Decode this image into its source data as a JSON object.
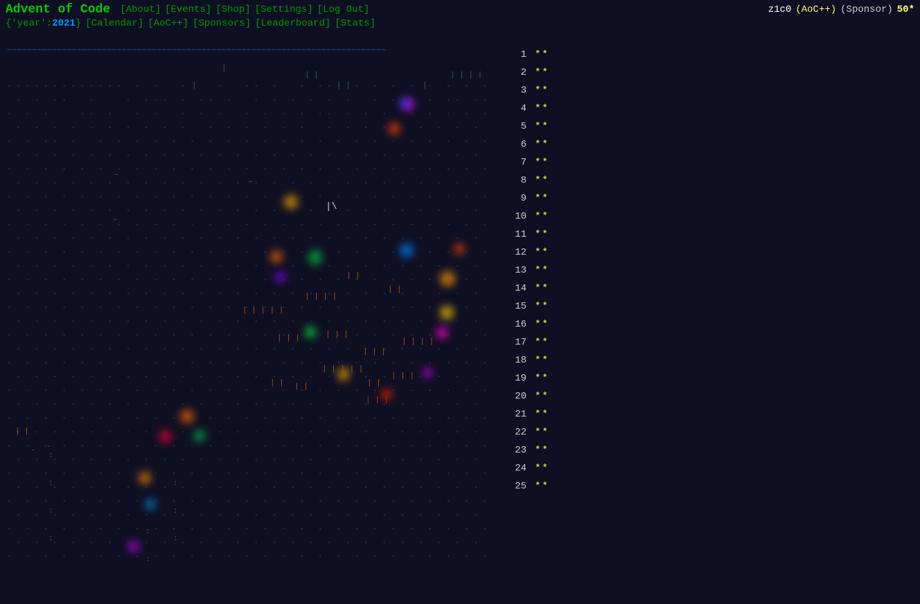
{
  "header": {
    "title": "Advent of Code",
    "nav_row1": [
      {
        "label": "[About]",
        "href": "#about"
      },
      {
        "label": "[Events]",
        "href": "#events"
      },
      {
        "label": "[Shop]",
        "href": "#shop"
      },
      {
        "label": "[Settings]",
        "href": "#settings"
      },
      {
        "label": "[Log Out]",
        "href": "#logout"
      }
    ],
    "user": {
      "name": "z1c0",
      "aocpp": "(AoC++)",
      "sponsor": "(Sponsor)",
      "stars": "50*"
    },
    "nav_row2": [
      {
        "label": "{'year':2021}"
      },
      {
        "label": "[Calendar]",
        "href": "#calendar"
      },
      {
        "label": "[AoC++]",
        "href": "#aocpp"
      },
      {
        "label": "[Sponsors]",
        "href": "#sponsors"
      },
      {
        "label": "[Leaderboard]",
        "href": "#leaderboard"
      },
      {
        "label": "[Stats]",
        "href": "#stats"
      }
    ]
  },
  "calendar": {
    "tilde_row": "~~~~~~~~~~~~~~~~~~~~~~~~~~~~~~~~~~~~~~~~~~~~~~~~~~~~~~~~~~~~~~~~~~~~~~~~~~~~"
  },
  "days": [
    {
      "num": "1",
      "stars": "**"
    },
    {
      "num": "2",
      "stars": "**"
    },
    {
      "num": "3",
      "stars": "**"
    },
    {
      "num": "4",
      "stars": "**"
    },
    {
      "num": "5",
      "stars": "**"
    },
    {
      "num": "6",
      "stars": "**"
    },
    {
      "num": "7",
      "stars": "**"
    },
    {
      "num": "8",
      "stars": "**"
    },
    {
      "num": "9",
      "stars": "**"
    },
    {
      "num": "10",
      "stars": "**"
    },
    {
      "num": "11",
      "stars": "**"
    },
    {
      "num": "12",
      "stars": "**"
    },
    {
      "num": "13",
      "stars": "**"
    },
    {
      "num": "14",
      "stars": "**"
    },
    {
      "num": "15",
      "stars": "**"
    },
    {
      "num": "16",
      "stars": "**"
    },
    {
      "num": "17",
      "stars": "**"
    },
    {
      "num": "18",
      "stars": "**"
    },
    {
      "num": "19",
      "stars": "**"
    },
    {
      "num": "20",
      "stars": "**"
    },
    {
      "num": "21",
      "stars": "**"
    },
    {
      "num": "22",
      "stars": "**"
    },
    {
      "num": "23",
      "stars": "**"
    },
    {
      "num": "24",
      "stars": "**"
    },
    {
      "num": "25",
      "stars": "**"
    }
  ]
}
